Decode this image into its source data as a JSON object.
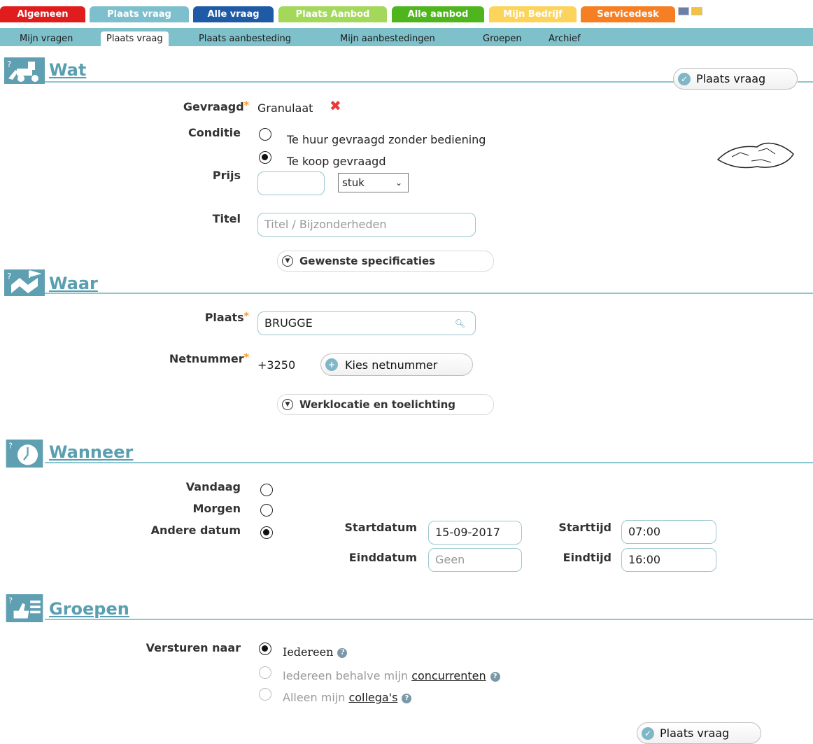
{
  "top_tabs": [
    {
      "label": "Algemeen",
      "color": "#e11c1c"
    },
    {
      "label": "Plaats vraag",
      "color": "#7dbfcc"
    },
    {
      "label": "Alle vraag",
      "color": "#1e5aa5"
    },
    {
      "label": "Plaats Aanbod",
      "color": "#a4d85a"
    },
    {
      "label": "Alle aanbod",
      "color": "#4fb51d"
    },
    {
      "label": "Mijn Bedrijf",
      "color": "#fcd45b"
    },
    {
      "label": "Servicedesk",
      "color": "#f77f23"
    }
  ],
  "sub_tabs": [
    "Mijn vragen",
    "Plaats vraag",
    "Plaats aanbesteding",
    "Mijn aanbestedingen",
    "Groepen",
    "Archief"
  ],
  "sections": {
    "wat": "Wat",
    "waar": "Waar",
    "wanneer": "Wanneer",
    "groepen": "Groepen"
  },
  "submit_label": "Plaats vraag",
  "wat": {
    "gevraagd_label": "Gevraagd",
    "gevraagd_value": "Granulaat",
    "conditie_label": "Conditie",
    "conditie_options": [
      "Te huur gevraagd zonder bediening",
      "Te koop gevraagd"
    ],
    "conditie_selected": 1,
    "prijs_label": "Prijs",
    "prijs_unit": "stuk",
    "titel_label": "Titel",
    "titel_placeholder": "Titel / Bijzonderheden",
    "specs_button": "Gewenste specificaties"
  },
  "waar": {
    "plaats_label": "Plaats",
    "plaats_value": "BRUGGE",
    "netnummer_label": "Netnummer",
    "netnummer_value": "+3250",
    "kies_button": "Kies netnummer",
    "werklocatie_button": "Werklocatie en toelichting"
  },
  "wanneer": {
    "options": [
      "Vandaag",
      "Morgen",
      "Andere datum"
    ],
    "selected": 2,
    "startdatum_label": "Startdatum",
    "startdatum_value": "15-09-2017",
    "einddatum_label": "Einddatum",
    "einddatum_placeholder": "Geen",
    "starttijd_label": "Starttijd",
    "starttijd_value": "07:00",
    "eindtijd_label": "Eindtijd",
    "eindtijd_value": "16:00"
  },
  "groepen": {
    "versturen_label": "Versturen naar",
    "opt1": "Iedereen",
    "opt2_prefix": "Iedereen behalve mijn ",
    "opt2_link": "concurrenten",
    "opt3_prefix": "Alleen mijn ",
    "opt3_link": "collega's"
  },
  "icons": [
    "help-icon",
    "search-icon",
    "plus-icon",
    "check-icon",
    "chevron-down-icon"
  ]
}
